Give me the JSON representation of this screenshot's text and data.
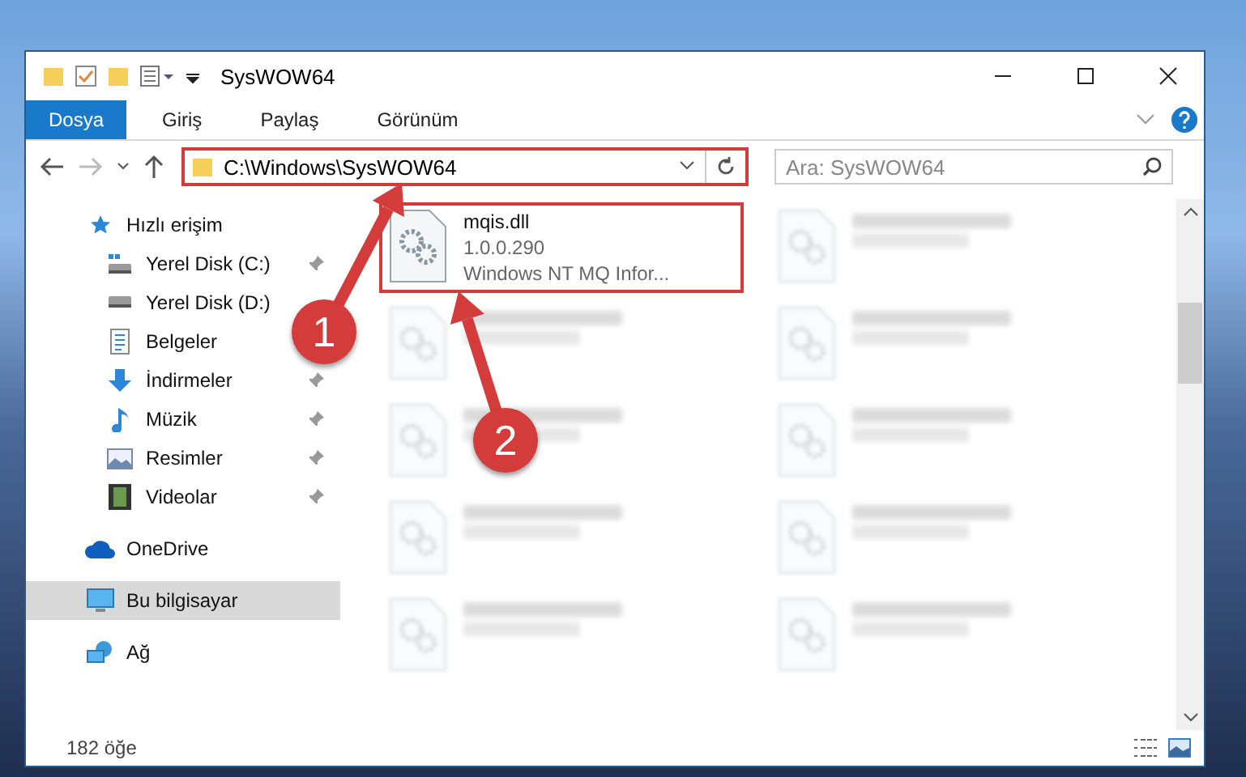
{
  "window": {
    "title": "SysWOW64"
  },
  "ribbon_tabs": [
    {
      "label": "Dosya",
      "selected": true
    },
    {
      "label": "Giriş",
      "selected": false
    },
    {
      "label": "Paylaş",
      "selected": false
    },
    {
      "label": "Görünüm",
      "selected": false
    }
  ],
  "address": {
    "path": "C:\\Windows\\SysWOW64",
    "highlighted": true
  },
  "search": {
    "placeholder": "Ara: SysWOW64"
  },
  "sidebar": {
    "items": [
      {
        "label": "Hızlı erişim",
        "kind": "star",
        "selected": false,
        "children": [
          {
            "label": "Yerel Disk (C:)",
            "kind": "windrive",
            "pinned": true,
            "selected": false
          },
          {
            "label": "Yerel Disk (D:)",
            "kind": "drive",
            "pinned": false,
            "selected": false
          },
          {
            "label": "Belgeler",
            "kind": "document",
            "pinned": false,
            "selected": false
          },
          {
            "label": "İndirmeler",
            "kind": "download",
            "pinned": true,
            "selected": false
          },
          {
            "label": "Müzik",
            "kind": "music",
            "pinned": true,
            "selected": false
          },
          {
            "label": "Resimler",
            "kind": "picture",
            "pinned": true,
            "selected": false
          },
          {
            "label": "Videolar",
            "kind": "video",
            "pinned": true,
            "selected": false
          }
        ]
      },
      {
        "label": "OneDrive",
        "kind": "cloud",
        "selected": false
      },
      {
        "label": "Bu bilgisayar",
        "kind": "computer",
        "selected": true
      },
      {
        "label": "Ağ",
        "kind": "network",
        "selected": false
      }
    ]
  },
  "files": [
    {
      "name": "mqis.dll",
      "details": [
        "1.0.0.290",
        "Windows NT MQ Infor..."
      ],
      "highlighted": true,
      "blurred": false
    },
    {
      "highlighted": false,
      "blurred": true
    },
    {
      "highlighted": false,
      "blurred": true
    },
    {
      "highlighted": false,
      "blurred": true
    },
    {
      "highlighted": false,
      "blurred": true
    },
    {
      "highlighted": false,
      "blurred": true
    },
    {
      "highlighted": false,
      "blurred": true
    },
    {
      "highlighted": false,
      "blurred": true
    },
    {
      "highlighted": false,
      "blurred": true
    },
    {
      "highlighted": false,
      "blurred": true
    }
  ],
  "annotations": [
    {
      "number": "1"
    },
    {
      "number": "2"
    }
  ],
  "status_bar": {
    "count": "182 öğe"
  }
}
